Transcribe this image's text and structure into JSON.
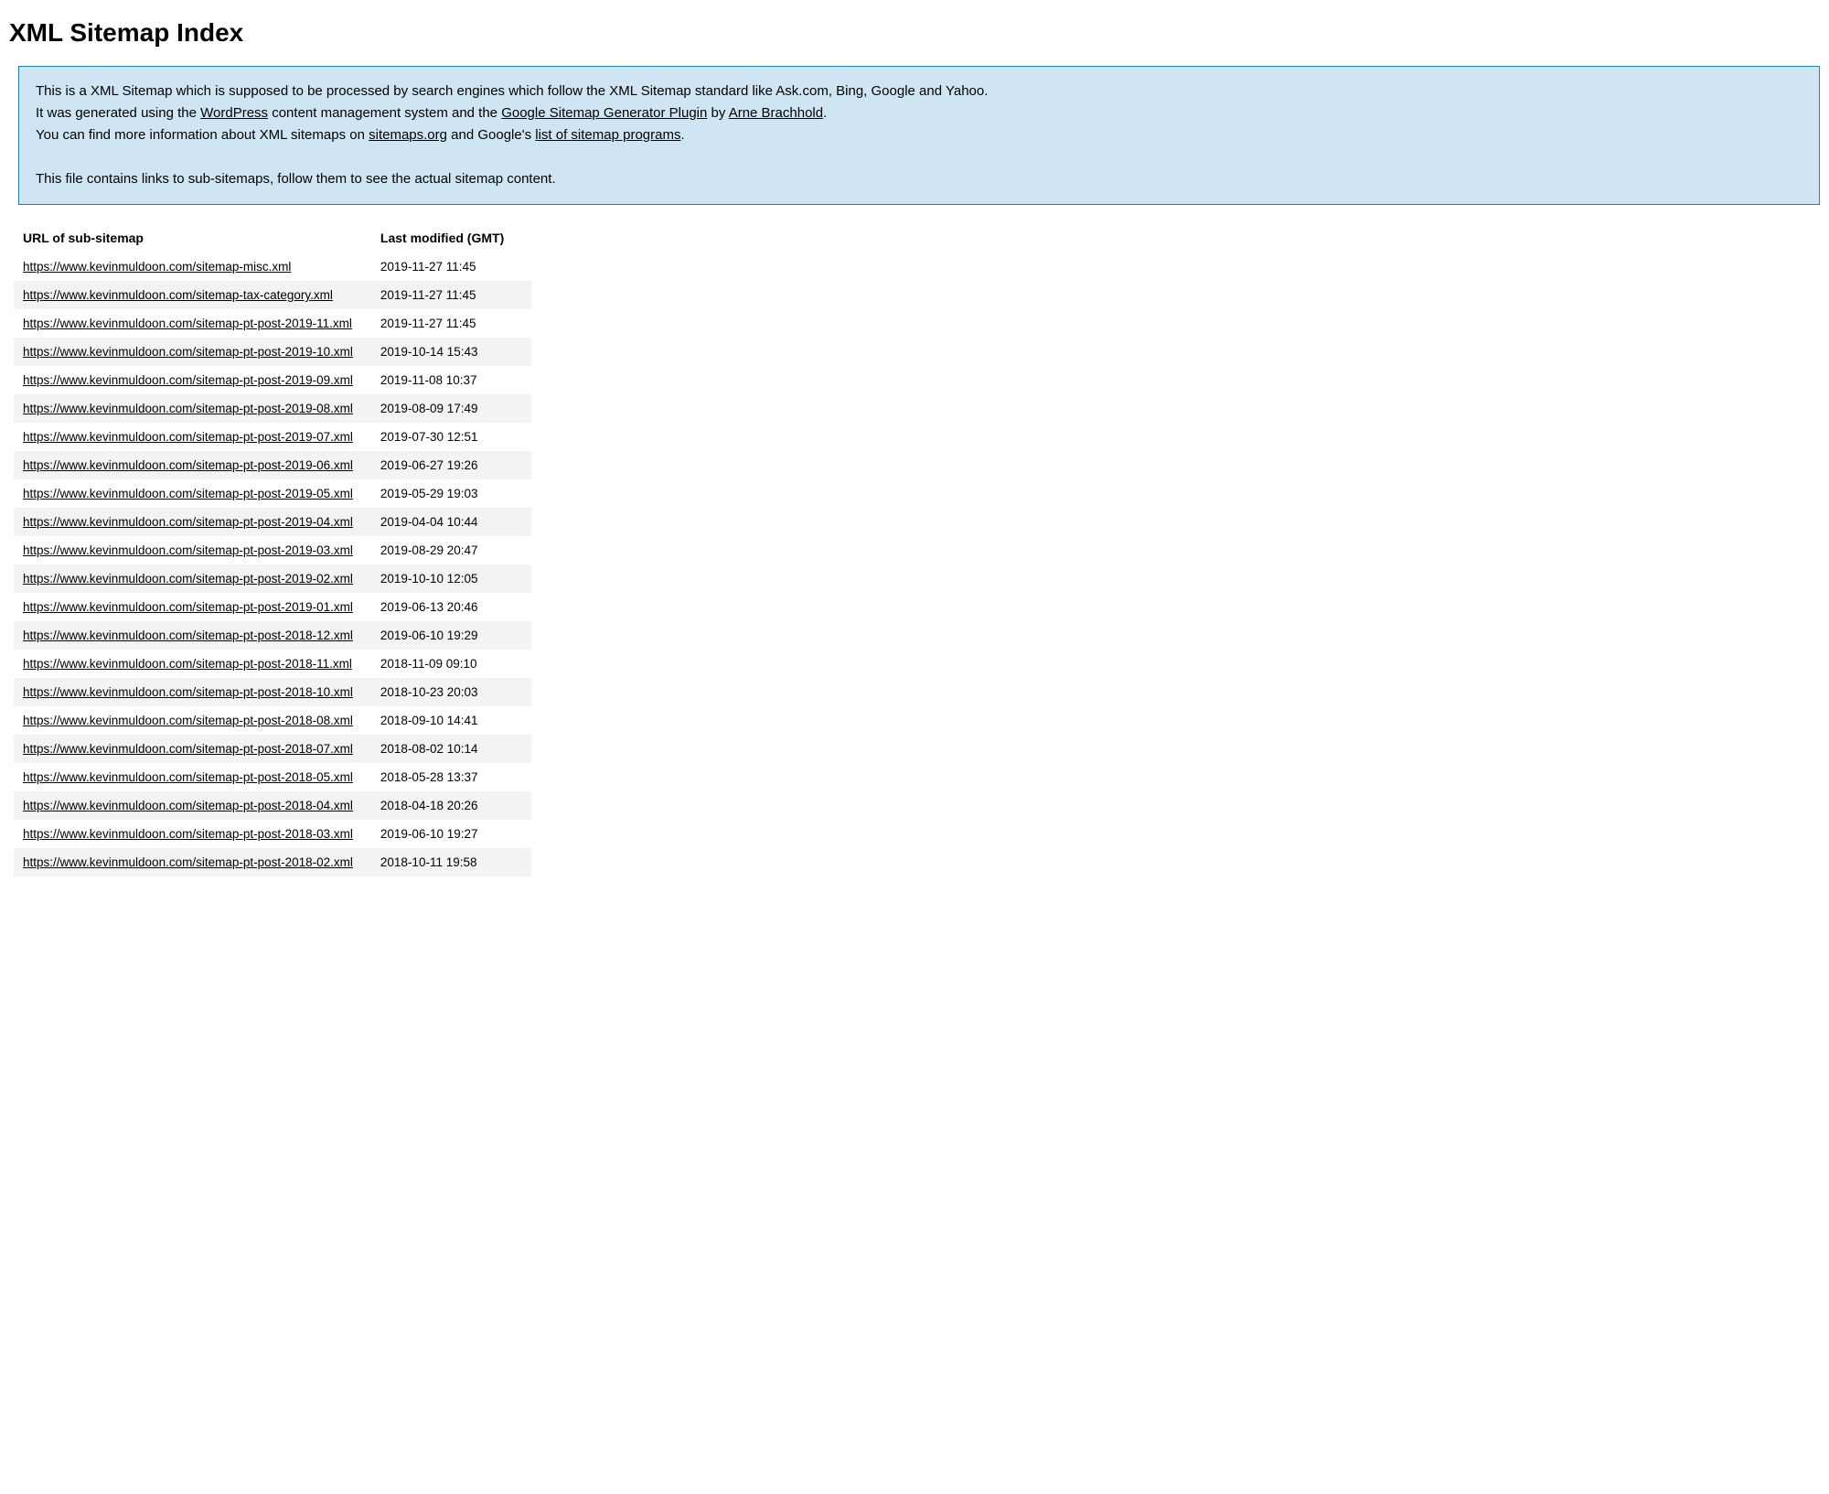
{
  "title": "XML Sitemap Index",
  "info": {
    "line1_pre": "This is a XML Sitemap which is supposed to be processed by search engines which follow the XML Sitemap standard like Ask.com, Bing, Google and Yahoo.",
    "line2_pre": "It was generated using the ",
    "link_wordpress": "WordPress",
    "line2_mid": " content management system and the ",
    "link_plugin": "Google Sitemap Generator Plugin",
    "line2_by": " by ",
    "link_author": "Arne Brachhold",
    "line2_end": ".",
    "line3_pre": "You can find more information about XML sitemaps on ",
    "link_sitemaps": "sitemaps.org",
    "line3_mid": " and Google's ",
    "link_google": "list of sitemap programs",
    "line3_end": ".",
    "line4": "This file contains links to sub-sitemaps, follow them to see the actual sitemap content."
  },
  "table": {
    "header_url": "URL of sub-sitemap",
    "header_date": "Last modified (GMT)",
    "rows": [
      {
        "url": "https://www.kevinmuldoon.com/sitemap-misc.xml",
        "date": "2019-11-27 11:45"
      },
      {
        "url": "https://www.kevinmuldoon.com/sitemap-tax-category.xml",
        "date": "2019-11-27 11:45"
      },
      {
        "url": "https://www.kevinmuldoon.com/sitemap-pt-post-2019-11.xml",
        "date": "2019-11-27 11:45"
      },
      {
        "url": "https://www.kevinmuldoon.com/sitemap-pt-post-2019-10.xml",
        "date": "2019-10-14 15:43"
      },
      {
        "url": "https://www.kevinmuldoon.com/sitemap-pt-post-2019-09.xml",
        "date": "2019-11-08 10:37"
      },
      {
        "url": "https://www.kevinmuldoon.com/sitemap-pt-post-2019-08.xml",
        "date": "2019-08-09 17:49"
      },
      {
        "url": "https://www.kevinmuldoon.com/sitemap-pt-post-2019-07.xml",
        "date": "2019-07-30 12:51"
      },
      {
        "url": "https://www.kevinmuldoon.com/sitemap-pt-post-2019-06.xml",
        "date": "2019-06-27 19:26"
      },
      {
        "url": "https://www.kevinmuldoon.com/sitemap-pt-post-2019-05.xml",
        "date": "2019-05-29 19:03"
      },
      {
        "url": "https://www.kevinmuldoon.com/sitemap-pt-post-2019-04.xml",
        "date": "2019-04-04 10:44"
      },
      {
        "url": "https://www.kevinmuldoon.com/sitemap-pt-post-2019-03.xml",
        "date": "2019-08-29 20:47"
      },
      {
        "url": "https://www.kevinmuldoon.com/sitemap-pt-post-2019-02.xml",
        "date": "2019-10-10 12:05"
      },
      {
        "url": "https://www.kevinmuldoon.com/sitemap-pt-post-2019-01.xml",
        "date": "2019-06-13 20:46"
      },
      {
        "url": "https://www.kevinmuldoon.com/sitemap-pt-post-2018-12.xml",
        "date": "2019-06-10 19:29"
      },
      {
        "url": "https://www.kevinmuldoon.com/sitemap-pt-post-2018-11.xml",
        "date": "2018-11-09 09:10"
      },
      {
        "url": "https://www.kevinmuldoon.com/sitemap-pt-post-2018-10.xml",
        "date": "2018-10-23 20:03"
      },
      {
        "url": "https://www.kevinmuldoon.com/sitemap-pt-post-2018-08.xml",
        "date": "2018-09-10 14:41"
      },
      {
        "url": "https://www.kevinmuldoon.com/sitemap-pt-post-2018-07.xml",
        "date": "2018-08-02 10:14"
      },
      {
        "url": "https://www.kevinmuldoon.com/sitemap-pt-post-2018-05.xml",
        "date": "2018-05-28 13:37"
      },
      {
        "url": "https://www.kevinmuldoon.com/sitemap-pt-post-2018-04.xml",
        "date": "2018-04-18 20:26"
      },
      {
        "url": "https://www.kevinmuldoon.com/sitemap-pt-post-2018-03.xml",
        "date": "2019-06-10 19:27"
      },
      {
        "url": "https://www.kevinmuldoon.com/sitemap-pt-post-2018-02.xml",
        "date": "2018-10-11 19:58"
      }
    ]
  }
}
